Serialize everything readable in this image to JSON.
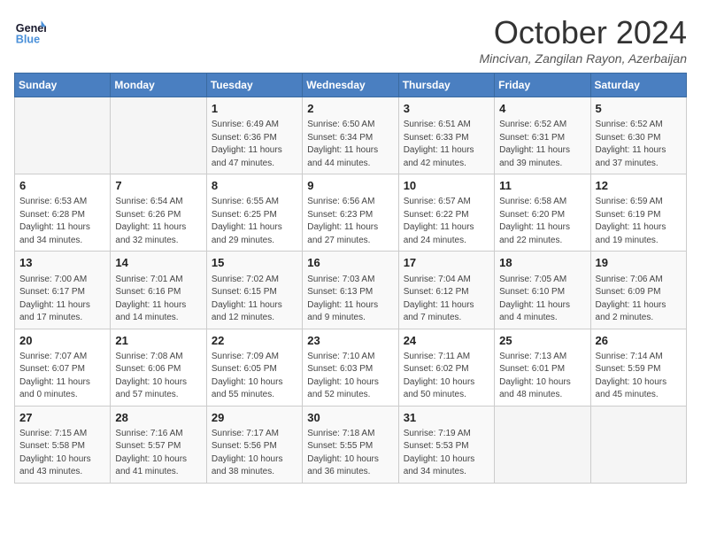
{
  "header": {
    "logo_line1": "General",
    "logo_line2": "Blue",
    "month": "October 2024",
    "location": "Mincivan, Zangilan Rayon, Azerbaijan"
  },
  "days_of_week": [
    "Sunday",
    "Monday",
    "Tuesday",
    "Wednesday",
    "Thursday",
    "Friday",
    "Saturday"
  ],
  "weeks": [
    [
      {
        "day": "",
        "info": ""
      },
      {
        "day": "",
        "info": ""
      },
      {
        "day": "1",
        "info": "Sunrise: 6:49 AM\nSunset: 6:36 PM\nDaylight: 11 hours and 47 minutes."
      },
      {
        "day": "2",
        "info": "Sunrise: 6:50 AM\nSunset: 6:34 PM\nDaylight: 11 hours and 44 minutes."
      },
      {
        "day": "3",
        "info": "Sunrise: 6:51 AM\nSunset: 6:33 PM\nDaylight: 11 hours and 42 minutes."
      },
      {
        "day": "4",
        "info": "Sunrise: 6:52 AM\nSunset: 6:31 PM\nDaylight: 11 hours and 39 minutes."
      },
      {
        "day": "5",
        "info": "Sunrise: 6:52 AM\nSunset: 6:30 PM\nDaylight: 11 hours and 37 minutes."
      }
    ],
    [
      {
        "day": "6",
        "info": "Sunrise: 6:53 AM\nSunset: 6:28 PM\nDaylight: 11 hours and 34 minutes."
      },
      {
        "day": "7",
        "info": "Sunrise: 6:54 AM\nSunset: 6:26 PM\nDaylight: 11 hours and 32 minutes."
      },
      {
        "day": "8",
        "info": "Sunrise: 6:55 AM\nSunset: 6:25 PM\nDaylight: 11 hours and 29 minutes."
      },
      {
        "day": "9",
        "info": "Sunrise: 6:56 AM\nSunset: 6:23 PM\nDaylight: 11 hours and 27 minutes."
      },
      {
        "day": "10",
        "info": "Sunrise: 6:57 AM\nSunset: 6:22 PM\nDaylight: 11 hours and 24 minutes."
      },
      {
        "day": "11",
        "info": "Sunrise: 6:58 AM\nSunset: 6:20 PM\nDaylight: 11 hours and 22 minutes."
      },
      {
        "day": "12",
        "info": "Sunrise: 6:59 AM\nSunset: 6:19 PM\nDaylight: 11 hours and 19 minutes."
      }
    ],
    [
      {
        "day": "13",
        "info": "Sunrise: 7:00 AM\nSunset: 6:17 PM\nDaylight: 11 hours and 17 minutes."
      },
      {
        "day": "14",
        "info": "Sunrise: 7:01 AM\nSunset: 6:16 PM\nDaylight: 11 hours and 14 minutes."
      },
      {
        "day": "15",
        "info": "Sunrise: 7:02 AM\nSunset: 6:15 PM\nDaylight: 11 hours and 12 minutes."
      },
      {
        "day": "16",
        "info": "Sunrise: 7:03 AM\nSunset: 6:13 PM\nDaylight: 11 hours and 9 minutes."
      },
      {
        "day": "17",
        "info": "Sunrise: 7:04 AM\nSunset: 6:12 PM\nDaylight: 11 hours and 7 minutes."
      },
      {
        "day": "18",
        "info": "Sunrise: 7:05 AM\nSunset: 6:10 PM\nDaylight: 11 hours and 4 minutes."
      },
      {
        "day": "19",
        "info": "Sunrise: 7:06 AM\nSunset: 6:09 PM\nDaylight: 11 hours and 2 minutes."
      }
    ],
    [
      {
        "day": "20",
        "info": "Sunrise: 7:07 AM\nSunset: 6:07 PM\nDaylight: 11 hours and 0 minutes."
      },
      {
        "day": "21",
        "info": "Sunrise: 7:08 AM\nSunset: 6:06 PM\nDaylight: 10 hours and 57 minutes."
      },
      {
        "day": "22",
        "info": "Sunrise: 7:09 AM\nSunset: 6:05 PM\nDaylight: 10 hours and 55 minutes."
      },
      {
        "day": "23",
        "info": "Sunrise: 7:10 AM\nSunset: 6:03 PM\nDaylight: 10 hours and 52 minutes."
      },
      {
        "day": "24",
        "info": "Sunrise: 7:11 AM\nSunset: 6:02 PM\nDaylight: 10 hours and 50 minutes."
      },
      {
        "day": "25",
        "info": "Sunrise: 7:13 AM\nSunset: 6:01 PM\nDaylight: 10 hours and 48 minutes."
      },
      {
        "day": "26",
        "info": "Sunrise: 7:14 AM\nSunset: 5:59 PM\nDaylight: 10 hours and 45 minutes."
      }
    ],
    [
      {
        "day": "27",
        "info": "Sunrise: 7:15 AM\nSunset: 5:58 PM\nDaylight: 10 hours and 43 minutes."
      },
      {
        "day": "28",
        "info": "Sunrise: 7:16 AM\nSunset: 5:57 PM\nDaylight: 10 hours and 41 minutes."
      },
      {
        "day": "29",
        "info": "Sunrise: 7:17 AM\nSunset: 5:56 PM\nDaylight: 10 hours and 38 minutes."
      },
      {
        "day": "30",
        "info": "Sunrise: 7:18 AM\nSunset: 5:55 PM\nDaylight: 10 hours and 36 minutes."
      },
      {
        "day": "31",
        "info": "Sunrise: 7:19 AM\nSunset: 5:53 PM\nDaylight: 10 hours and 34 minutes."
      },
      {
        "day": "",
        "info": ""
      },
      {
        "day": "",
        "info": ""
      }
    ]
  ]
}
